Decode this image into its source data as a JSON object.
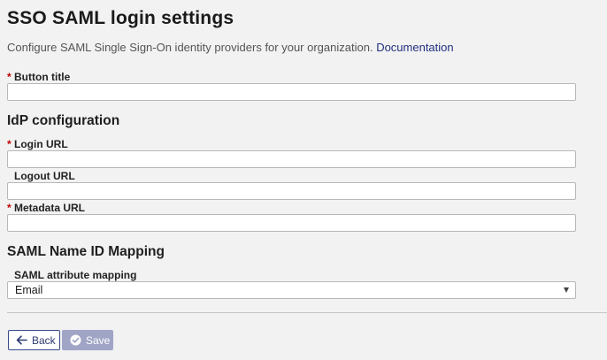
{
  "header": {
    "title": "SSO SAML login settings",
    "description": "Configure SAML Single Sign-On identity providers for your organization.",
    "doc_link": "Documentation"
  },
  "fields": {
    "button_title": {
      "label": "Button title",
      "required": true,
      "value": ""
    },
    "login_url": {
      "label": "Login URL",
      "required": true,
      "value": ""
    },
    "logout_url": {
      "label": "Logout URL",
      "required": false,
      "value": ""
    },
    "metadata_url": {
      "label": "Metadata URL",
      "required": true,
      "value": ""
    }
  },
  "sections": {
    "idp": "IdP configuration",
    "mapping": "SAML Name ID Mapping"
  },
  "mapping": {
    "label": "SAML attribute mapping",
    "selected": "Email"
  },
  "required_marker": "*",
  "buttons": {
    "back": {
      "label": "Back",
      "icon": "arrow-left-icon"
    },
    "save": {
      "label": "Save",
      "icon": "check-circle-icon",
      "disabled": true
    }
  },
  "colors": {
    "background": "#f2f2f2",
    "link": "#22307f",
    "required": "#c00000",
    "primary_border": "#3a4a8c",
    "save_disabled": "#a0a5c6"
  }
}
